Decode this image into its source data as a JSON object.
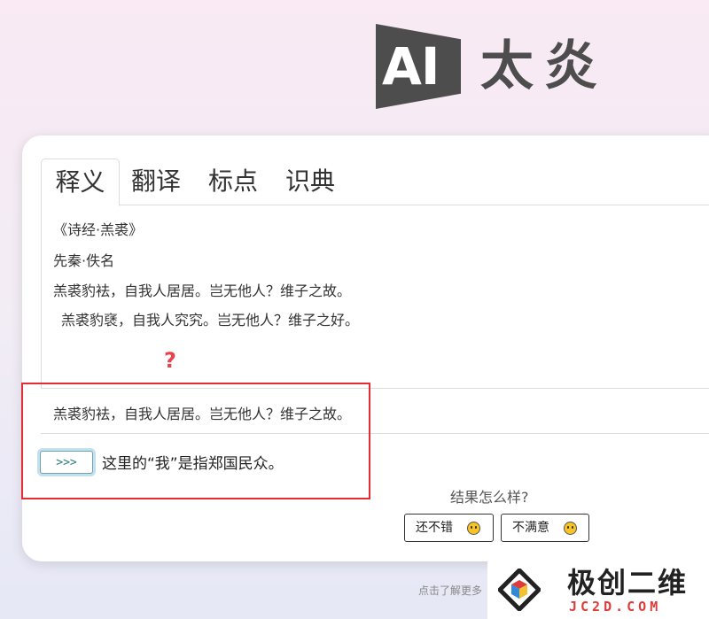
{
  "logo": {
    "mark_text": "AI",
    "name_text": "太炎"
  },
  "tabs": [
    {
      "label": "释义",
      "active": true
    },
    {
      "label": "翻译",
      "active": false
    },
    {
      "label": "标点",
      "active": false
    },
    {
      "label": "识典",
      "active": false
    }
  ],
  "passage": {
    "title": "《诗经·羔裘》",
    "author": "先秦·佚名",
    "line1": "羔裘豹袪，自我人居居。岂无他人？维子之故。",
    "line2": "羔裘豹褎，自我人究究。岂无他人？维子之好。"
  },
  "annotation_mark": "?",
  "selected_sentence": "羔裘豹袪，自我人居居。岂无他人？维子之故。",
  "run_button_label": ">>>",
  "answer_text": "这里的“我”是指郑国民众。",
  "feedback": {
    "question": "结果怎么样?",
    "good_label": "还不错",
    "bad_label": "不满意"
  },
  "footer_link": "点击了解更多",
  "watermark": {
    "title": "极创二维",
    "subtitle": "JC2D.COM"
  },
  "colors": {
    "highlight": "#e32d32",
    "logo": "#4d4d4d",
    "run_button": "#2a7d7d"
  }
}
